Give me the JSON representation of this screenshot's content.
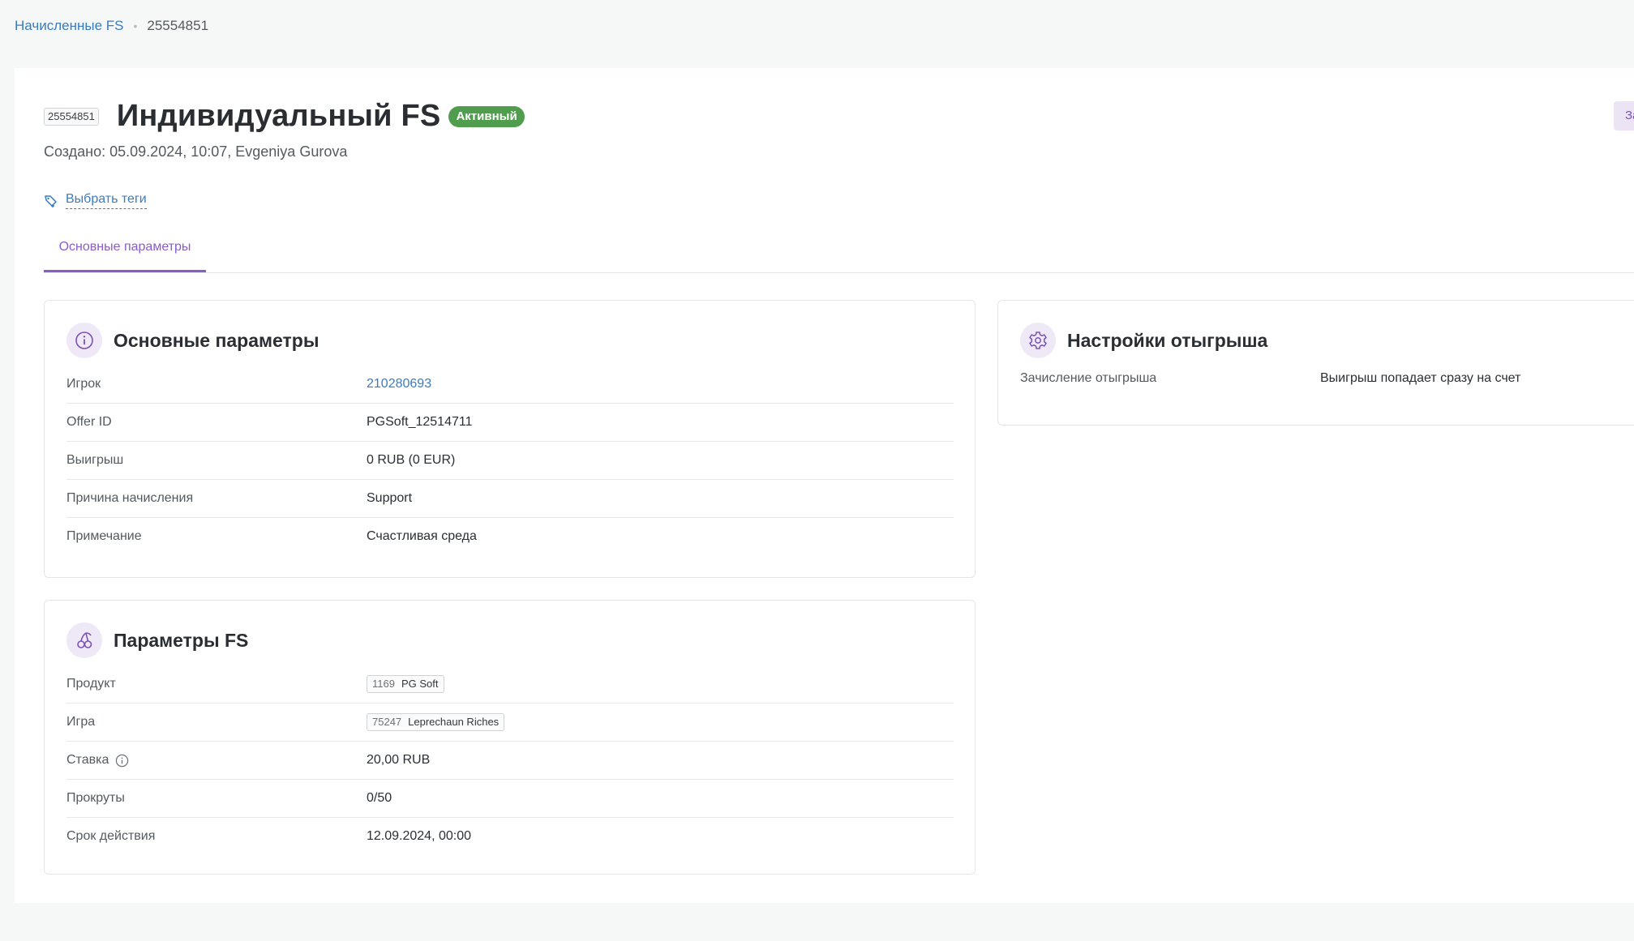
{
  "breadcrumb": {
    "parent": "Начисленные FS",
    "separator": "•",
    "current": "25554851"
  },
  "header": {
    "id_chip": "25554851",
    "title": "Индивидуальный FS",
    "status": "Активный",
    "created": "Создано: 05.09.2024, 10:07, Evgeniya Gurova",
    "tags_button": "Выбрать теги",
    "edge_button": "За"
  },
  "tabs": [
    {
      "label": "Основные параметры",
      "active": true
    }
  ],
  "main_params": {
    "title": "Основные параметры",
    "icon": "info-icon",
    "rows": [
      {
        "label": "Игрок",
        "value": "210280693"
      },
      {
        "label": "Offer ID",
        "value": "PGSoft_12514711"
      },
      {
        "label": "Выигрыш",
        "value": "0 RUB (0 EUR)"
      },
      {
        "label": "Причина начисления",
        "value": "Support"
      },
      {
        "label": "Примечание",
        "value": "Счастливая среда"
      }
    ]
  },
  "fs_params": {
    "title": "Параметры FS",
    "icon": "cherries-icon",
    "product": {
      "label": "Продукт",
      "id": "1169",
      "name": "PG Soft"
    },
    "game": {
      "label": "Игра",
      "id": "75247",
      "name": "Leprechaun Riches"
    },
    "bet": {
      "label": "Ставка",
      "value": "20,00 RUB"
    },
    "spins": {
      "label": "Прокруты",
      "value": "0/50"
    },
    "expiry": {
      "label": "Срок действия",
      "value": "12.09.2024, 00:00"
    }
  },
  "wager_settings": {
    "title": "Настройки отыгрыша",
    "icon": "gear-icon",
    "rows": [
      {
        "label": "Зачисление отыгрыша",
        "value": "Выигрыш попадает сразу на счет"
      }
    ]
  },
  "colors": {
    "accent": "#8a5cc8",
    "link": "#3b7bbf",
    "status_active": "#4f9d4d"
  }
}
